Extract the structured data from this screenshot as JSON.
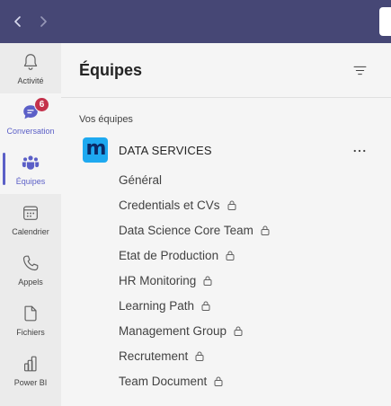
{
  "titlebar": {
    "back_icon": "chevron-left-icon",
    "forward_icon": "chevron-right-icon",
    "color": "#464775"
  },
  "rail": {
    "items": [
      {
        "label": "Activité",
        "icon": "bell-icon",
        "state": "normal"
      },
      {
        "label": "Conversation",
        "icon": "chat-icon",
        "state": "hover",
        "badge": "6"
      },
      {
        "label": "Équipes",
        "icon": "teams-icon",
        "state": "active"
      },
      {
        "label": "Calendrier",
        "icon": "calendar-icon",
        "state": "normal"
      },
      {
        "label": "Appels",
        "icon": "phone-icon",
        "state": "normal"
      },
      {
        "label": "Fichiers",
        "icon": "file-icon",
        "state": "normal"
      },
      {
        "label": "Power BI",
        "icon": "powerbi-icon",
        "state": "normal"
      }
    ]
  },
  "panel": {
    "title": "Équipes",
    "filter_icon": "filter-icon",
    "section_label": "Vos équipes",
    "team": {
      "name": "DATA SERVICES",
      "avatar_letter": "m",
      "avatar_color": "#1ea9f0",
      "more_label": "•••",
      "channels": [
        {
          "name": "Général",
          "private": false
        },
        {
          "name": "Credentials et CVs",
          "private": true
        },
        {
          "name": "Data Science Core Team",
          "private": true
        },
        {
          "name": "Etat de Production",
          "private": true
        },
        {
          "name": "HR Monitoring",
          "private": true
        },
        {
          "name": "Learning Path",
          "private": true
        },
        {
          "name": "Management Group",
          "private": true
        },
        {
          "name": "Recrutement",
          "private": true
        },
        {
          "name": "Team Document",
          "private": true
        }
      ]
    }
  },
  "colors": {
    "accent": "#5b5fc7",
    "badge": "#c4314b"
  }
}
